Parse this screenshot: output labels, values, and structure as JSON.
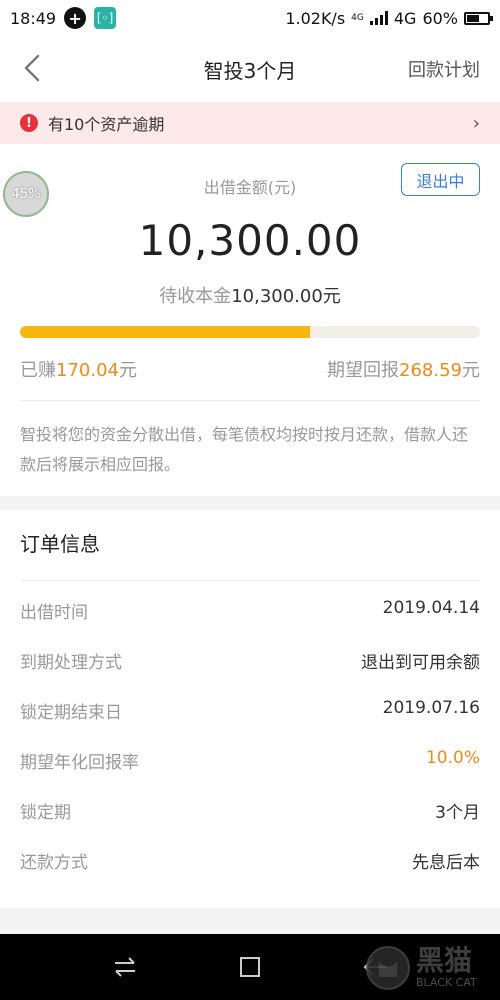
{
  "status_bar": {
    "time": "18:49",
    "speed": "1.02K/s",
    "net_small": "4G",
    "network": "4G",
    "battery": "60%",
    "battery_level": 0.6
  },
  "header": {
    "title": "智投3个月",
    "plan_link": "回款计划"
  },
  "overdue": {
    "text": "有10个资产逾期"
  },
  "summary": {
    "progress_badge": "45%",
    "amount_label": "出借金额(元)",
    "status_button": "退出中",
    "amount": "10,300.00",
    "principal_label": "待收本金",
    "principal_value": "10,300.00元",
    "progress_fraction": 0.63,
    "earned_label": "已赚",
    "earned_value": "170.04",
    "earned_unit": "元",
    "expected_label": "期望回报",
    "expected_value": "268.59",
    "expected_unit": "元",
    "description": "智投将您的资金分散出借，每笔债权均按时按月还款，借款人还款后将展示相应回报。"
  },
  "order": {
    "title": "订单信息",
    "rows": [
      {
        "key": "出借时间",
        "value": "2019.04.14"
      },
      {
        "key": "到期处理方式",
        "value": "退出到可用余额"
      },
      {
        "key": "锁定期结束日",
        "value": "2019.07.16"
      },
      {
        "key": "期望年化回报率",
        "value": "10.0%"
      },
      {
        "key": "锁定期",
        "value": "3个月"
      },
      {
        "key": "还款方式",
        "value": "先息后本"
      }
    ]
  },
  "watermark": {
    "cn": "黑猫",
    "en": "BLACK CAT"
  },
  "colors": {
    "accent_orange": "#f08a19",
    "progress_yellow": "#f6b60e",
    "button_blue": "#3b7de0",
    "warning_red": "#e7323a"
  }
}
